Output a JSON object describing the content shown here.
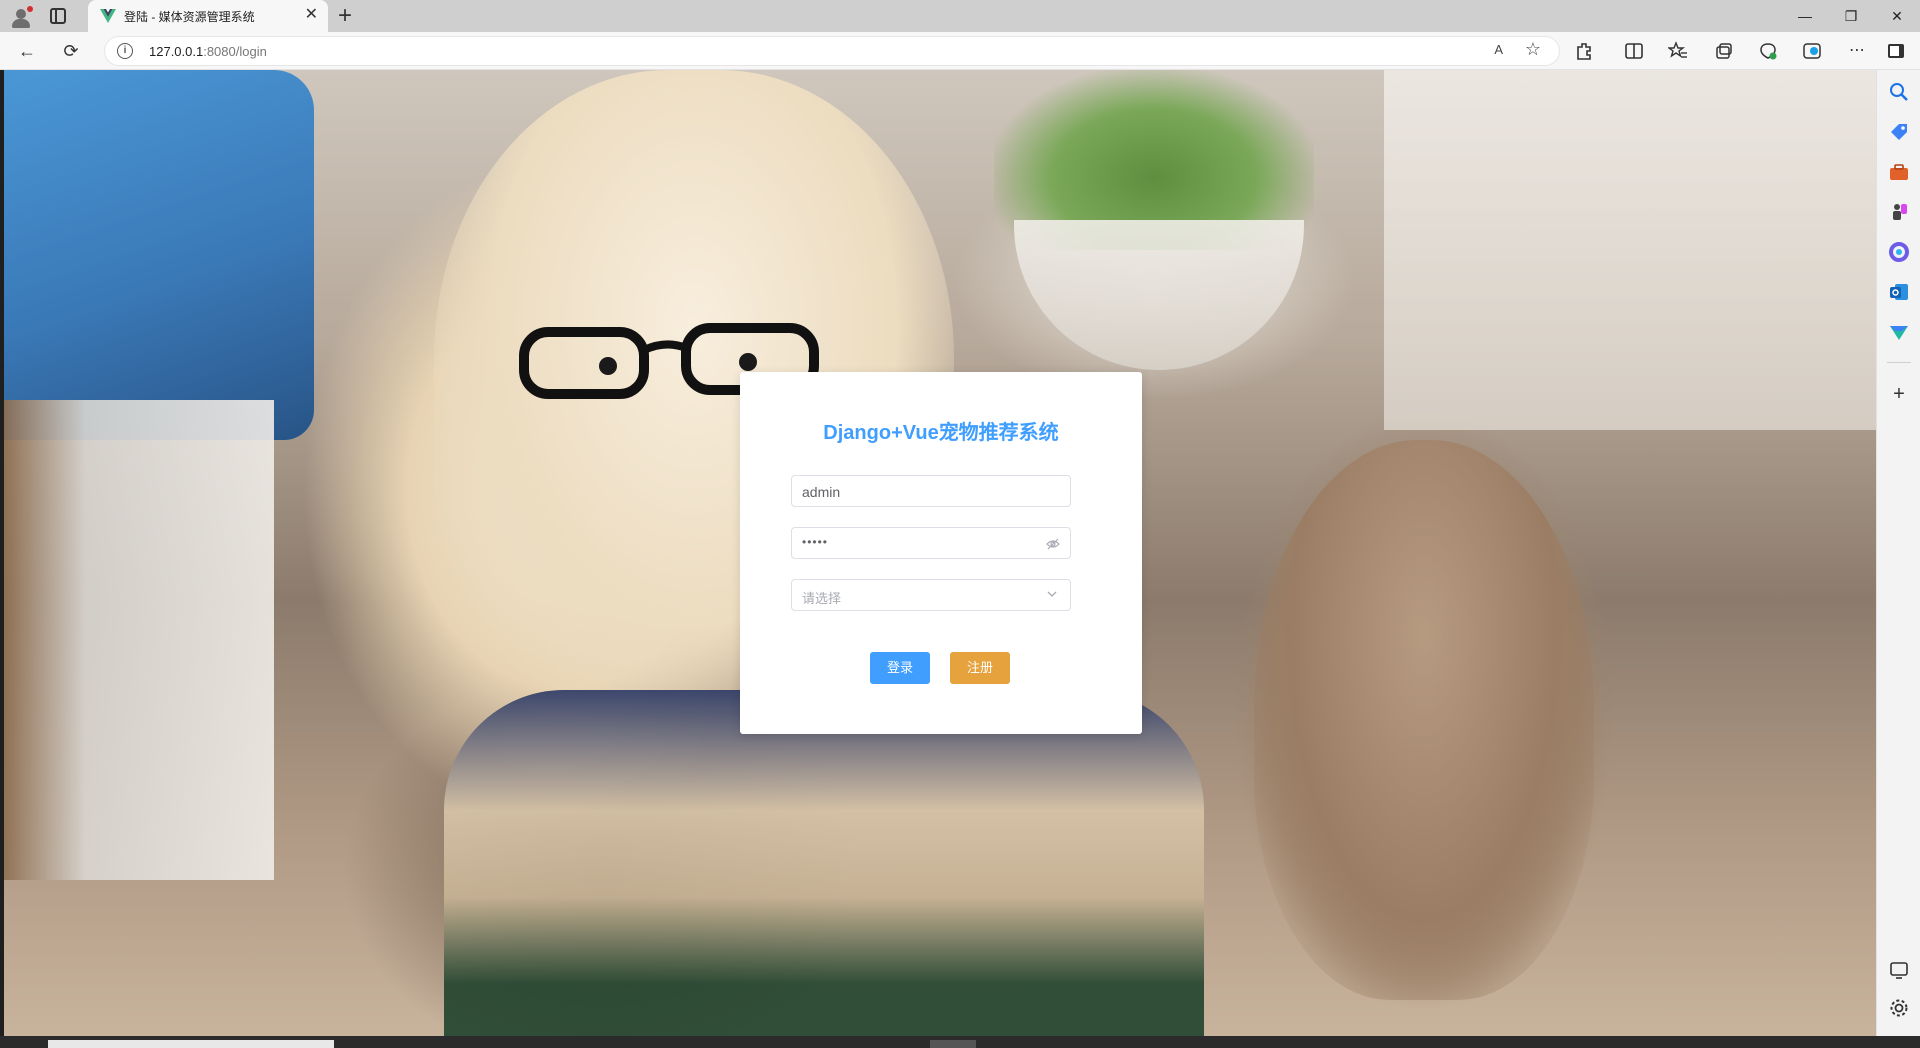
{
  "browser": {
    "tab": {
      "title": "登陆 - 媒体资源管理系统",
      "close": "✕",
      "favicon_icon": "vue-logo-icon"
    },
    "new_tab": "+",
    "window_controls": {
      "minimize": "—",
      "restore": "❐",
      "close": "✕"
    },
    "address_bar": {
      "host": "127.0.0.1",
      "path": ":8080/login",
      "read_aloud": "A",
      "favorite": "☆"
    },
    "nav": {
      "back": "←",
      "refresh": "⟳"
    },
    "toolbar_icons": [
      "extensions-icon",
      "split-screen-icon",
      "favorites-icon",
      "collections-icon",
      "browser-essentials-icon",
      "copilot-icon",
      "more-icon",
      "sidebar-toggle-icon"
    ],
    "sidebar_icons": [
      "search-icon",
      "shopping-icon",
      "tools-icon",
      "games-icon",
      "microsoft365-icon",
      "outlook-icon",
      "drop-icon",
      "add-icon",
      "screenshot-icon",
      "settings-icon"
    ]
  },
  "login": {
    "title": "Django+Vue宠物推荐系统",
    "username": {
      "value": "admin"
    },
    "password": {
      "mask": "•••••"
    },
    "role_select": {
      "placeholder": "请选择"
    },
    "login_button": "登录",
    "register_button": "注册"
  },
  "colors": {
    "primary": "#409eff",
    "warning": "#e6a23c"
  }
}
